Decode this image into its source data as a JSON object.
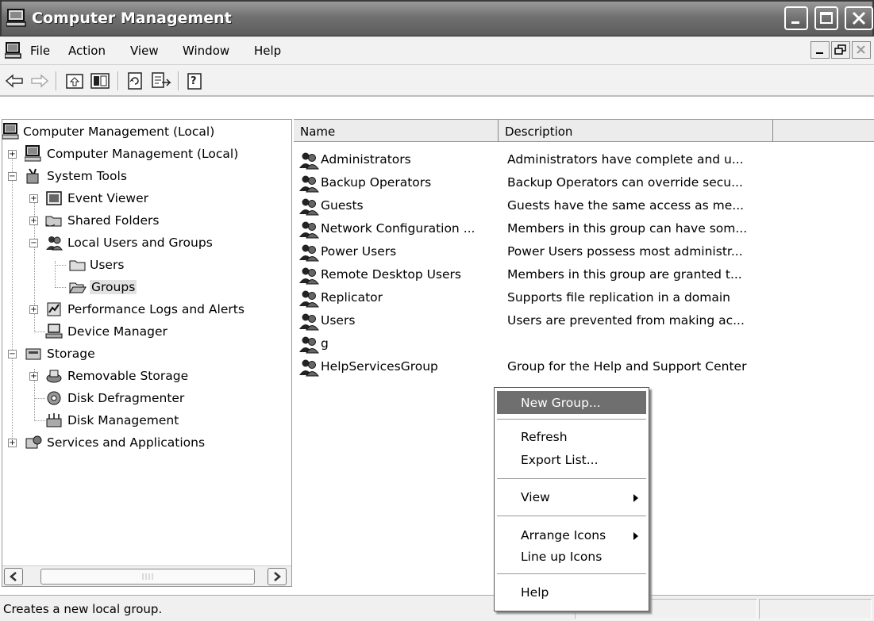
{
  "window": {
    "title": "Computer Management"
  },
  "menubar": {
    "items": [
      "File",
      "Action",
      "View",
      "Window",
      "Help"
    ]
  },
  "toolbar": {
    "buttons": [
      "back-icon",
      "forward-icon",
      "up-one-level-icon",
      "show-hide-tree-icon",
      "refresh-icon",
      "export-list-icon",
      "help-icon"
    ]
  },
  "tree": {
    "root": "Computer Management (Local)",
    "items": [
      {
        "label": "Computer Management (Local)",
        "icon": "computer-icon"
      },
      {
        "label": "System Tools",
        "icon": "tools-icon"
      },
      {
        "label": "Event Viewer",
        "icon": "event-viewer-icon"
      },
      {
        "label": "Shared Folders",
        "icon": "shared-folder-icon"
      },
      {
        "label": "Local Users and Groups",
        "icon": "users-icon"
      },
      {
        "label": "Users",
        "icon": "folder-icon"
      },
      {
        "label": "Groups",
        "icon": "folder-open-icon"
      },
      {
        "label": "Performance Logs and Alerts",
        "icon": "performance-icon"
      },
      {
        "label": "Device Manager",
        "icon": "device-manager-icon"
      },
      {
        "label": "Storage",
        "icon": "storage-icon"
      },
      {
        "label": "Removable Storage",
        "icon": "removable-storage-icon"
      },
      {
        "label": "Disk Defragmenter",
        "icon": "defrag-icon"
      },
      {
        "label": "Disk Management",
        "icon": "disk-management-icon"
      },
      {
        "label": "Services and Applications",
        "icon": "services-icon"
      }
    ]
  },
  "list": {
    "columns": [
      "Name",
      "Description"
    ],
    "rows": [
      {
        "name": "Administrators",
        "description": "Administrators have complete and u..."
      },
      {
        "name": "Backup Operators",
        "description": "Backup Operators can override secu..."
      },
      {
        "name": "Guests",
        "description": "Guests have the same access as me..."
      },
      {
        "name": "Network Configuration ...",
        "description": "Members in this group can have som..."
      },
      {
        "name": "Power Users",
        "description": "Power Users possess most administr..."
      },
      {
        "name": "Remote Desktop Users",
        "description": "Members in this group are granted t..."
      },
      {
        "name": "Replicator",
        "description": "Supports file replication in a domain"
      },
      {
        "name": "Users",
        "description": "Users are prevented from making ac..."
      },
      {
        "name": "g",
        "description": ""
      },
      {
        "name": "HelpServicesGroup",
        "description": "Group for the Help and Support Center"
      }
    ]
  },
  "context_menu": {
    "items": [
      "New Group...",
      "Refresh",
      "Export List...",
      "View",
      "Arrange Icons",
      "Line up Icons",
      "Help"
    ]
  },
  "status": {
    "text": "Creates a new local group."
  }
}
